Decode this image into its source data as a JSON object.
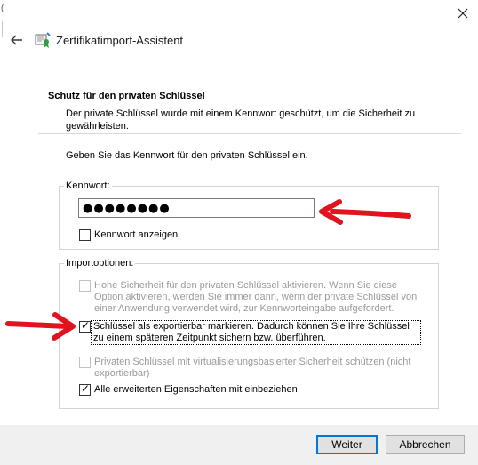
{
  "window": {
    "edge_fragment": "(",
    "title": "Zertifikatimport-Assistent",
    "back_icon": "back-arrow-icon",
    "close_icon": "close-icon",
    "app_icon": "certificate-icon"
  },
  "section": {
    "title": "Schutz für den privaten Schlüssel",
    "description": "Der private Schlüssel wurde mit einem Kennwort geschützt, um die Sicherheit zu gewährleisten.",
    "prompt": "Geben Sie das Kennwort für den privaten Schlüssel ein."
  },
  "password_group": {
    "legend": "Kennwort:",
    "value": "●●●●●●●●",
    "show_password": {
      "label": "Kennwort anzeigen",
      "checked": false
    }
  },
  "import_options": {
    "legend": "Importoptionen:",
    "options": [
      {
        "label": "Hohe Sicherheit für den privaten Schlüssel aktivieren. Wenn Sie diese Option aktivieren, werden Sie immer dann, wenn der private Schlüssel von einer Anwendung verwendet wird, zur Kennworteingabe aufgefordert.",
        "checked": false,
        "enabled": false
      },
      {
        "label": "Schlüssel als exportierbar markieren. Dadurch können Sie Ihre Schlüssel zu einem späteren Zeitpunkt sichern bzw. überführen.",
        "checked": true,
        "enabled": true
      },
      {
        "label": "Privaten Schlüssel mit virtualisierungsbasierter Sicherheit schützen (nicht exportierbar)",
        "checked": false,
        "enabled": false
      },
      {
        "label": "Alle erweiterten Eigenschaften mit einbeziehen",
        "checked": true,
        "enabled": true
      }
    ]
  },
  "buttons": {
    "next": "Weiter",
    "cancel": "Abbrechen"
  },
  "colors": {
    "accent": "#0078d7",
    "annotation_arrow": "#e0141e",
    "footer_bg": "#f0f0f0"
  }
}
